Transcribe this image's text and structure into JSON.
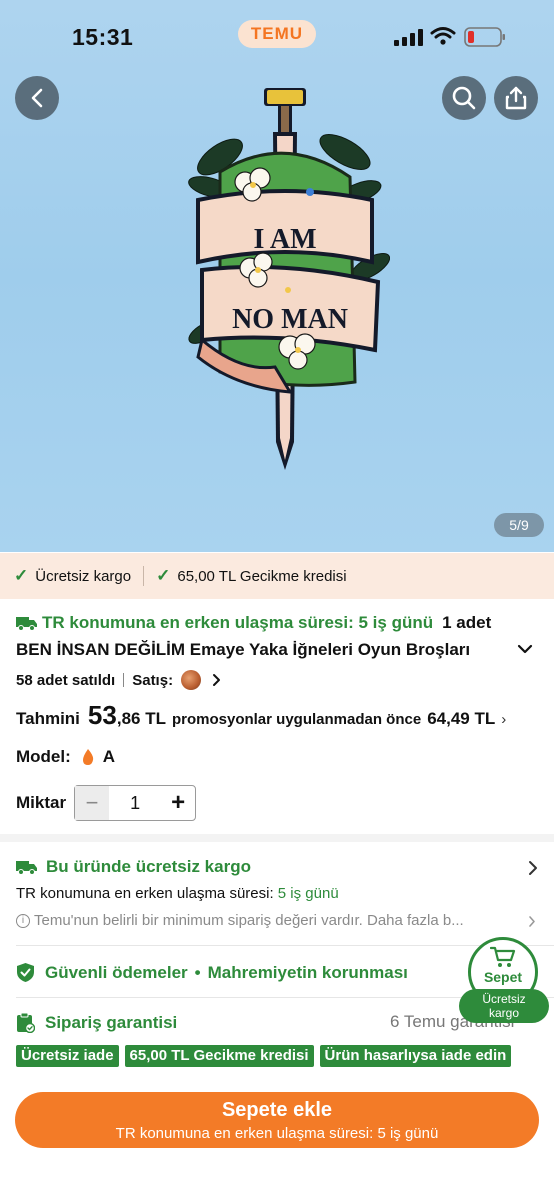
{
  "status_bar": {
    "time": "15:31",
    "app_badge": "TEMU"
  },
  "hero": {
    "image_counter": "5/9",
    "pin_text_line1": "I AM",
    "pin_text_line2": "NO MAN"
  },
  "promo_band": {
    "free_shipping": "Ücretsiz kargo",
    "delay_credit": "65,00 TL Gecikme kredisi"
  },
  "product": {
    "delivery_text": "TR konumuna en erken ulaşma süresi: 5 iş günü",
    "quantity_text": "1 adet",
    "title": "BEN İNSAN DEĞİLİM Emaye Yaka İğneleri Oyun Broşları",
    "sold": "58 adet satıldı",
    "seller_label": "Satış:",
    "price_label": "Tahmini",
    "price_whole": "53",
    "price_rest": ",86 TL",
    "price_note": "promosyonlar uygulanmadan önce",
    "price_old": "64,49 TL",
    "model_label": "Model:",
    "model_value": "A",
    "qty_label": "Miktar",
    "qty_value": "1"
  },
  "shipping": {
    "title": "Bu üründe ücretsiz kargo",
    "sub_label": "TR konumuna en erken ulaşma süresi:",
    "sub_value": "5 iş günü",
    "note": "Temu'nun belirli bir minimum sipariş değeri vardır. Daha fazla b..."
  },
  "secure": {
    "payments": "Güvenli ödemeler",
    "dot": "•",
    "privacy": "Mahremiyetin korunması"
  },
  "guarantee": {
    "title": "Sipariş garantisi",
    "right": "6 Temu garantisi",
    "badges": [
      "Ücretsiz iade",
      "65,00 TL Gecikme kredisi",
      "Ürün hasarlıysa iade edin"
    ]
  },
  "cart_float": {
    "label": "Sepet",
    "tag_line1": "Ücretsiz",
    "tag_line2": "kargo"
  },
  "add_button": {
    "label": "Sepete ekle",
    "sub": "TR konumuna en erken ulaşma süresi: 5 iş günü"
  },
  "colors": {
    "accent_orange": "#f37b27",
    "green": "#2e8b3b",
    "hero_bg": "#a9d3ef"
  }
}
